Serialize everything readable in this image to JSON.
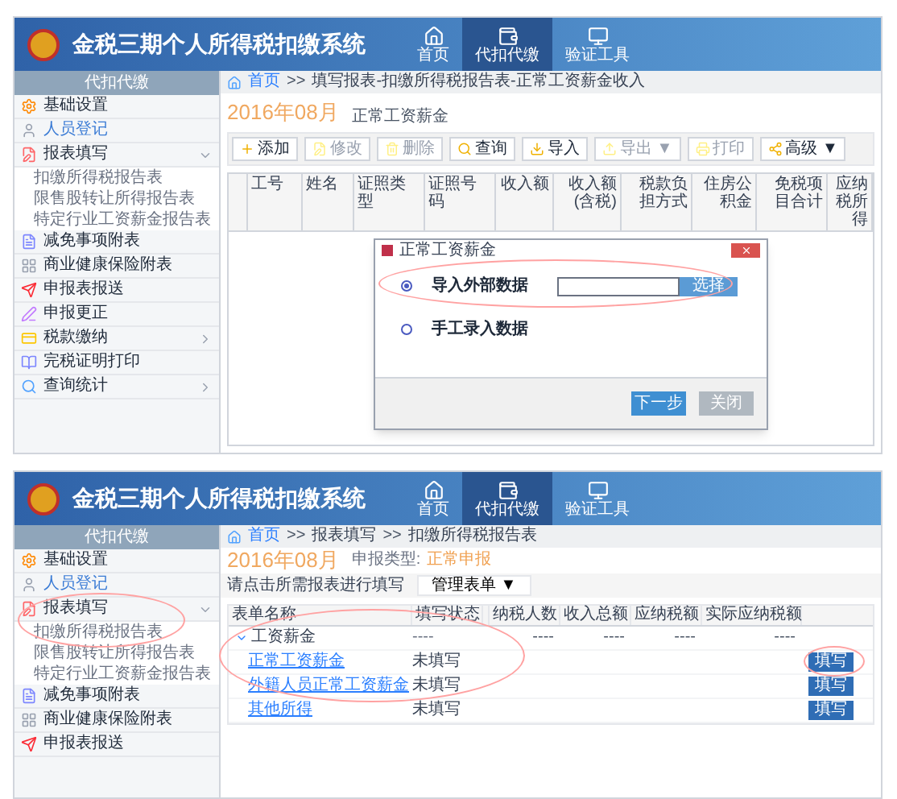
{
  "top_screen": {
    "header": {
      "title": "金税三期个人所得税扣缴系统",
      "nav": [
        {
          "label": "首页",
          "selected": false
        },
        {
          "label": "代扣代缴",
          "selected": true
        },
        {
          "label": "验证工具",
          "selected": false
        }
      ]
    },
    "sidebar": {
      "title": "代扣代缴",
      "items": [
        {
          "label": "基础设置",
          "selected": false
        },
        {
          "label": "人员登记",
          "selected": true
        },
        {
          "label": "报表填写",
          "selected": false,
          "expanded": true,
          "children": [
            {
              "label": "扣缴所得税报告表"
            },
            {
              "label": "限售股转让所得报告表"
            },
            {
              "label": "特定行业工资薪金报告表"
            }
          ]
        },
        {
          "label": "减免事项附表",
          "selected": false
        },
        {
          "label": "商业健康保险附表",
          "selected": false
        },
        {
          "label": "申报表报送",
          "selected": false
        },
        {
          "label": "申报更正",
          "selected": false
        },
        {
          "label": "税款缴纳",
          "selected": false,
          "expanded": false
        },
        {
          "label": "完税证明打印",
          "selected": false
        },
        {
          "label": "查询统计",
          "selected": false,
          "expanded": false
        }
      ]
    },
    "breadcrumb": {
      "separator": ">>",
      "items": [
        "首页",
        "填写报表-扣缴所得税报告表-正常工资薪金收入"
      ]
    },
    "period": "2016年08月",
    "subtitle": "正常工资薪金",
    "toolbar": [
      {
        "label": "添加",
        "disabled": false
      },
      {
        "label": "修改",
        "disabled": true
      },
      {
        "label": "删除",
        "disabled": true
      },
      {
        "label": "查询",
        "disabled": false
      },
      {
        "label": "导入",
        "disabled": false
      },
      {
        "label": "导出 ▼",
        "disabled": true
      },
      {
        "label": "打印",
        "disabled": true
      },
      {
        "label": "高级 ▼",
        "disabled": false
      }
    ],
    "table": {
      "columns": [
        "工号",
        "姓名",
        "证照类型",
        "证照号码",
        "收入额",
        "收入额(含税)",
        "税款负担方式",
        "住房公积金",
        "免税项目合计",
        "应纳税所得"
      ]
    },
    "dialog": {
      "title": "正常工资薪金",
      "options": [
        {
          "kind": "file",
          "label": "导入外部数据",
          "selected": true,
          "button": "选择"
        },
        {
          "kind": "plain",
          "label": "手工录入数据",
          "selected": false
        }
      ],
      "buttons": [
        {
          "label": "下一步",
          "disabled": false
        },
        {
          "label": "关闭",
          "disabled": true
        }
      ]
    }
  },
  "bottom_screen": {
    "header": {
      "title": "金税三期个人所得税扣缴系统",
      "nav": [
        {
          "label": "首页",
          "selected": false
        },
        {
          "label": "代扣代缴",
          "selected": true
        },
        {
          "label": "验证工具",
          "selected": false
        }
      ]
    },
    "sidebar": {
      "title": "代扣代缴",
      "items": [
        {
          "label": "基础设置",
          "selected": false
        },
        {
          "label": "人员登记",
          "selected": true
        },
        {
          "label": "报表填写",
          "selected": false,
          "expanded": true,
          "children": [
            {
              "label": "扣缴所得税报告表"
            },
            {
              "label": "限售股转让所得报告表"
            },
            {
              "label": "特定行业工资薪金报告表"
            }
          ]
        },
        {
          "label": "减免事项附表",
          "selected": false
        },
        {
          "label": "商业健康保险附表",
          "selected": false
        },
        {
          "label": "申报表报送",
          "selected": false
        }
      ]
    },
    "breadcrumb": {
      "separator": ">>",
      "items": [
        "首页",
        "报表填写",
        "扣缴所得税报告表"
      ]
    },
    "period": "2016年08月",
    "type_label": "申报类型:",
    "type_value": "正常申报",
    "hint": "请点击所需报表进行填写",
    "manage_button": "管理表单 ▼",
    "table": {
      "columns": [
        "表单名称",
        "填写状态",
        "纳税人数",
        "收入总额",
        "应纳税额",
        "实际应纳税额"
      ],
      "rows": [
        {
          "name": "工资薪金",
          "status": "----",
          "values": [
            "----",
            "----",
            "----",
            "----"
          ],
          "expanded": true,
          "children": [
            {
              "name": "正常工资薪金",
              "status": "未填写",
              "action": "填写"
            },
            {
              "name": "外籍人员正常工资薪金",
              "status": "未填写",
              "action": "填写"
            }
          ]
        },
        {
          "name": "其他所得",
          "status": "未填写",
          "action": "填写"
        }
      ]
    }
  }
}
